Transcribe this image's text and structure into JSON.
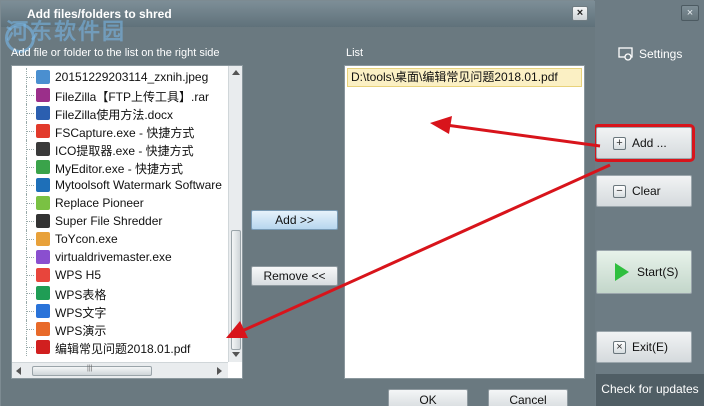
{
  "app": {
    "settings_label": "Settings",
    "add_label": "Add ...",
    "clear_label": "Clear",
    "start_label": "Start(S)",
    "exit_label": "Exit(E)",
    "check_updates_label": "Check for updates"
  },
  "dialog": {
    "title": "Add files/folders to shred",
    "hint": "Add file or folder to the list on the right side",
    "list_label": "List",
    "add_files_label": "Add >>",
    "remove_label": "Remove <<",
    "ok_label": "OK",
    "cancel_label": "Cancel",
    "tree_items": [
      {
        "label": "20151229203114_zxnih.jpeg",
        "icon": "image-file-icon",
        "color": "#4a8fd0"
      },
      {
        "label": "FileZilla【FTP上传工具】.rar",
        "icon": "archive-file-icon",
        "color": "#9b2f8a"
      },
      {
        "label": "FileZilla使用方法.docx",
        "icon": "word-document-icon",
        "color": "#2b5fb0"
      },
      {
        "label": "FSCapture.exe - 快捷方式",
        "icon": "fscapture-app-icon",
        "color": "#e23a2b"
      },
      {
        "label": "ICO提取器.exe - 快捷方式",
        "icon": "ico-extractor-app-icon",
        "color": "#3a3a3a"
      },
      {
        "label": "MyEditor.exe - 快捷方式",
        "icon": "myeditor-app-icon",
        "color": "#3aa34a"
      },
      {
        "label": "Mytoolsoft Watermark Software",
        "icon": "watermark-app-icon",
        "color": "#1e6fb8"
      },
      {
        "label": "Replace Pioneer",
        "icon": "replace-pioneer-app-icon",
        "color": "#7ac143"
      },
      {
        "label": "Super File Shredder",
        "icon": "shredder-app-icon",
        "color": "#333333"
      },
      {
        "label": "ToYcon.exe",
        "icon": "toycon-app-icon",
        "color": "#e8a13a"
      },
      {
        "label": "virtualdrivemaster.exe",
        "icon": "virtual-drive-app-icon",
        "color": "#8a4fcf"
      },
      {
        "label": "WPS H5",
        "icon": "wps-h5-icon",
        "color": "#e8453c"
      },
      {
        "label": "WPS表格",
        "icon": "wps-spreadsheet-icon",
        "color": "#1f9d55"
      },
      {
        "label": "WPS文字",
        "icon": "wps-writer-icon",
        "color": "#2a73d9"
      },
      {
        "label": "WPS演示",
        "icon": "wps-presentation-icon",
        "color": "#e86a2a"
      },
      {
        "label": "编辑常见问题2018.01.pdf",
        "icon": "pdf-file-icon",
        "color": "#d11f1f"
      }
    ],
    "list_items": [
      "D:\\tools\\桌面\\编辑常见问题2018.01.pdf"
    ]
  },
  "watermark": "河东软件园",
  "colors": {
    "annotation": "#d8141b",
    "titlebar": "#6d7f88",
    "selected_row": "#fbf0c4"
  }
}
